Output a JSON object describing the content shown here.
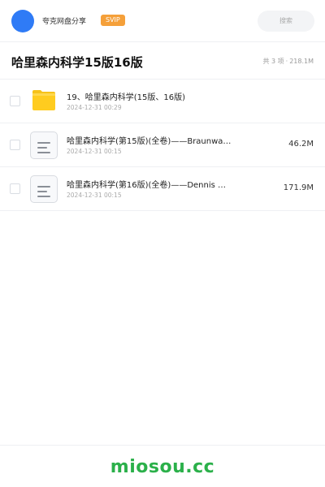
{
  "header": {
    "app_name": "夸克网盘分享",
    "badge": "SVIP",
    "search_placeholder": "搜索",
    "avatar_color": "#2f7bf6",
    "badge_color": "#f5a03a"
  },
  "folder": {
    "title": "哈里森内科学15版16版",
    "count_text": "共 3 项",
    "separator": "·",
    "total_size": "218.1M"
  },
  "files": [
    {
      "type": "folder-icon",
      "name": "19、哈里森内科学(15版、16版)",
      "time": "2024-12-31 00:29",
      "size": ""
    },
    {
      "type": "document-icon",
      "name": "哈里森内科学(第15版)(全卷)——Braunwa…",
      "time": "2024-12-31 00:15",
      "size": "46.2M"
    },
    {
      "type": "document-icon",
      "name": "哈里森内科学(第16版)(全卷)——Dennis …",
      "time": "2024-12-31 00:15",
      "size": "171.9M"
    }
  ],
  "footer": {
    "watermark": "miosou.cc",
    "watermark_color": "#2bb04a"
  }
}
